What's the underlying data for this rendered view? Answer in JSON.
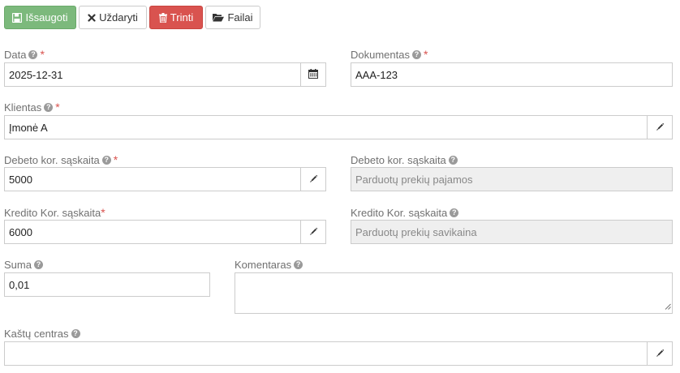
{
  "toolbar": {
    "save_label": "Išsaugoti",
    "close_label": "Uždaryti",
    "delete_label": "Trinti",
    "files_label": "Failai"
  },
  "fields": {
    "data": {
      "label": "Data",
      "value": "2025-12-31"
    },
    "dokumentas": {
      "label": "Dokumentas",
      "value": "AAA-123"
    },
    "klientas": {
      "label": "Klientas",
      "value": "Įmonė A"
    },
    "debeto_account": {
      "label": "Debeto kor. sąskaita",
      "value": "5000"
    },
    "debeto_name": {
      "label": "Debeto kor. sąskaita",
      "value": "Parduotų prekių pajamos"
    },
    "kredito_account": {
      "label": "Kredito Kor. sąskaita",
      "value": "6000"
    },
    "kredito_name": {
      "label": "Kredito Kor. sąskaita",
      "value": "Parduotų prekių savikaina"
    },
    "suma": {
      "label": "Suma",
      "value": "0,01"
    },
    "komentaras": {
      "label": "Komentaras",
      "value": ""
    },
    "kastu_centras": {
      "label": "Kaštų centras",
      "value": ""
    }
  },
  "markers": {
    "required": "*",
    "help": "?"
  },
  "colors": {
    "save": "#7cb97c",
    "delete": "#d9534f",
    "required": "#d9534f",
    "readonly_bg": "#efefef"
  },
  "icons": {
    "save": "floppy-disk-icon",
    "close": "close-icon",
    "delete": "trash-icon",
    "files": "folder-open-icon",
    "date": "calendar-icon",
    "edit": "pencil-icon",
    "help": "question-circle-icon"
  }
}
